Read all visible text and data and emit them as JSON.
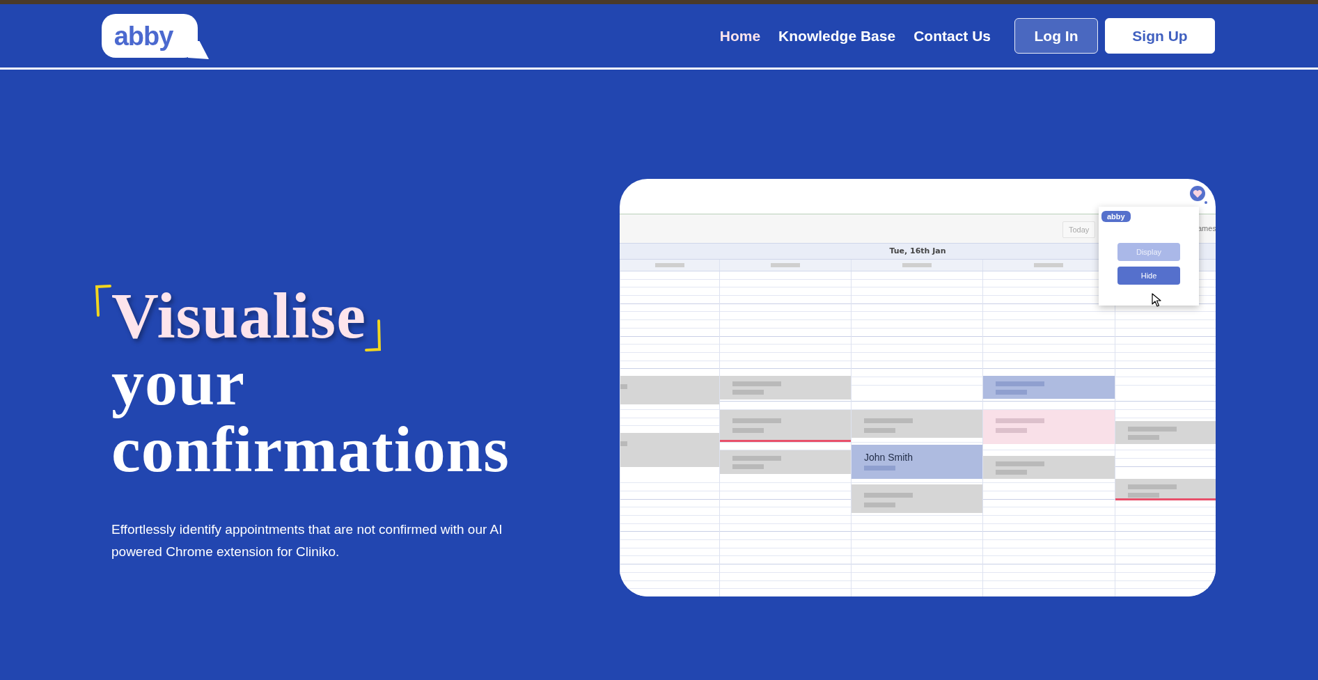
{
  "nav": {
    "logo": "abby",
    "links": [
      {
        "label": "Home",
        "selected": true
      },
      {
        "label": "Knowledge Base",
        "selected": false
      },
      {
        "label": "Contact Us",
        "selected": false
      }
    ],
    "buttons": [
      {
        "label": "Log In",
        "kind": "outline"
      },
      {
        "label": "Sign Up",
        "kind": "solid"
      }
    ]
  },
  "hero": {
    "headline": [
      {
        "text": "Visualise",
        "highlighted": true
      },
      {
        "text": "your",
        "highlighted": false
      },
      {
        "text": "confirmations",
        "highlighted": false
      }
    ],
    "description": "Effortlessly identify appointments that are not confirmed with our AI powered Chrome extension for Cliniko."
  },
  "preview": {
    "toolbar_button": "Today",
    "toolbar_cut_text": "ames",
    "date": "Tue, 16th Jan",
    "popup": {
      "logo": "abby",
      "buttons": [
        {
          "label": "Display",
          "selected": false
        },
        {
          "label": "Hide",
          "selected": true
        }
      ]
    },
    "columns": [
      {
        "appointments": [
          {
            "color": "#d6d6d6",
            "flagged": false
          },
          {
            "color": "#d6d6d6",
            "flagged": false
          }
        ]
      },
      {
        "appointments": [
          {
            "color": "#d6d6d6",
            "flagged": false
          },
          {
            "color": "#d6d6d6",
            "flagged": true
          },
          {
            "color": "#d6d6d6",
            "flagged": false
          }
        ]
      },
      {
        "appointments": [
          {
            "color": "#d6d6d6",
            "flagged": false
          },
          {
            "color": "#aebbe0",
            "flagged": false,
            "name": "John Smith"
          },
          {
            "color": "#d6d6d6",
            "flagged": false
          }
        ]
      },
      {
        "appointments": [
          {
            "color": "#aebbe0",
            "flagged": false
          },
          {
            "color": "#f9e0e8",
            "flagged": false
          },
          {
            "color": "#d6d6d6",
            "flagged": false
          }
        ]
      },
      {
        "appointments": [
          {
            "color": "#d6d6d6",
            "flagged": false
          },
          {
            "color": "#d6d6d6",
            "flagged": true
          }
        ]
      }
    ]
  }
}
